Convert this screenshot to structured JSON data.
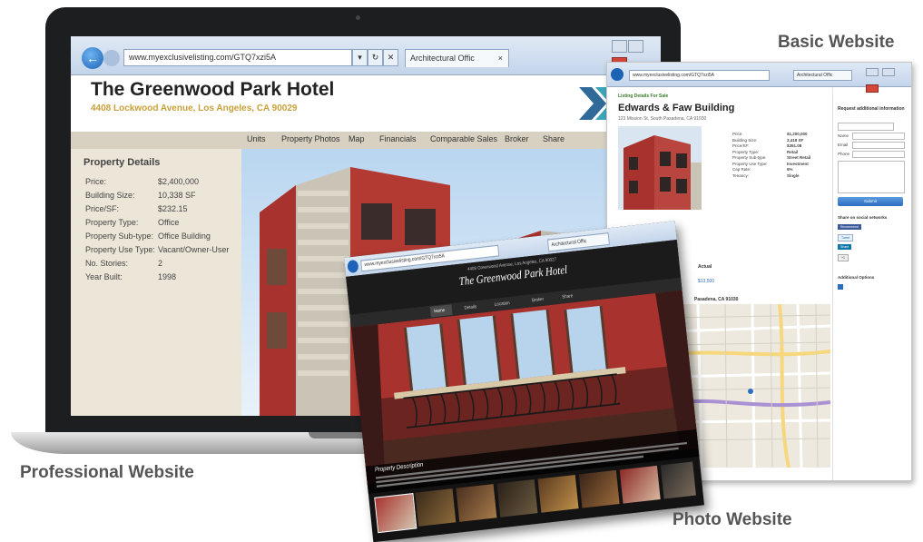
{
  "captions": {
    "basic": "Basic Website",
    "professional": "Professional Website",
    "photo": "Photo Website"
  },
  "laptop_browser": {
    "url": "www.myexclusivelisting.com/GTQ7xzi5A",
    "tab_label": "Architectural Offic",
    "tab_close": "×",
    "title": "The Greenwood Park Hotel",
    "address": "4408 Lockwood Avenue, Los Angeles, CA 90029",
    "nav": [
      "Units",
      "Property Photos",
      "Map",
      "Financials",
      "Comparable Sales",
      "Broker",
      "Share"
    ],
    "details_title": "Property Details",
    "details": [
      {
        "label": "Price:",
        "value": "$2,400,000"
      },
      {
        "label": "Building Size:",
        "value": "10,338 SF"
      },
      {
        "label": "Price/SF:",
        "value": "$232.15"
      },
      {
        "label": "Property Type:",
        "value": "Office"
      },
      {
        "label": "Property Sub-type:",
        "value": "Office Building"
      },
      {
        "label": "Property Use Type:",
        "value": "Vacant/Owner-User"
      },
      {
        "label": "No. Stories:",
        "value": "2"
      },
      {
        "label": "Year Built:",
        "value": "1998"
      }
    ]
  },
  "basic_site": {
    "url": "www.myexclusivelisting.com/GTQ7xzi5A",
    "tab_label": "Architectural Offic",
    "breadcrumb": "Listing Details For Sale",
    "title": "Edwards & Faw Building",
    "address": "123 Mission St, South Pasadena, CA 91030",
    "facts": [
      {
        "label": "Price:",
        "value": "$1,200,000"
      },
      {
        "label": "Building Size:",
        "value": "3,418 SF"
      },
      {
        "label": "Price/SF:",
        "value": "$351.08"
      },
      {
        "label": "Property Type:",
        "value": "Retail"
      },
      {
        "label": "Property Sub-type:",
        "value": "Street Retail"
      },
      {
        "label": "Property Use Type:",
        "value": "Investment"
      },
      {
        "label": "Cap Rate:",
        "value": "6%"
      },
      {
        "label": "Tenancy:",
        "value": "Single"
      }
    ],
    "request_title": "Request additional information",
    "form_labels": [
      "Name",
      "Email",
      "Phone"
    ],
    "button_label": "Submit",
    "share_title": "Share on social networks",
    "social": [
      "Recommend",
      "Tweet",
      "Share",
      "+1"
    ],
    "additional_title": "Additional Options",
    "map_caption": "Pasadena, CA 91030",
    "actual_label": "Actual",
    "actual_value": "$13,500"
  },
  "photo_site": {
    "url": "www.myexclusivelisting.com/GTQ7xzi5A",
    "tab_label": "Architectural Offic",
    "address": "4408 Greenwood Avenue, Los Angeles, CA 90027",
    "title": "The Greenwood Park Hotel",
    "nav": [
      "Home",
      "Details",
      "Location",
      "Broker",
      "Share"
    ],
    "desc_title": "Property Description"
  },
  "colors": {
    "accent_gold": "#c9a13b",
    "ie_blue": "#1c62b6",
    "building_red": "#a8332e"
  }
}
